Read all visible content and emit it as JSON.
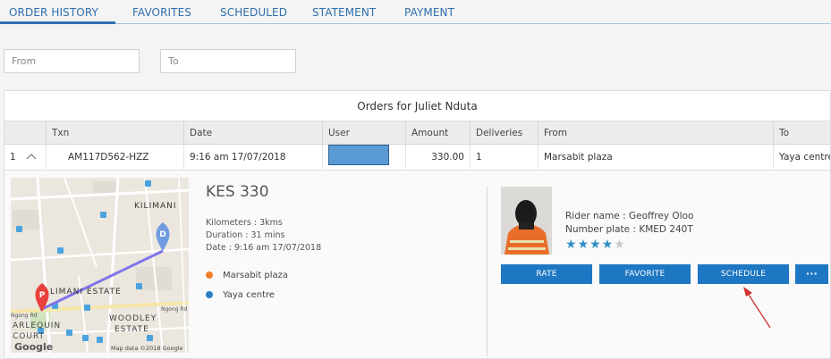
{
  "tabs": [
    {
      "label": "ORDER HISTORY",
      "active": true
    },
    {
      "label": "FAVORITES"
    },
    {
      "label": "SCHEDULED"
    },
    {
      "label": "STATEMENT"
    },
    {
      "label": "PAYMENT"
    }
  ],
  "filters": {
    "from_placeholder": "From",
    "to_placeholder": "To"
  },
  "grid": {
    "title": "Orders for Juliet Nduta",
    "columns": [
      "",
      "Txn",
      "Date",
      "User",
      "Amount",
      "Deliveries",
      "From",
      "To"
    ],
    "rows": [
      {
        "index": "1",
        "txn": "AM117D562-HZZ",
        "date": "9:16 am 17/07/2018",
        "user": "",
        "amount": "330.00",
        "deliveries": "1",
        "from": "Marsabit plaza",
        "to": "Yaya centre"
      }
    ]
  },
  "detail": {
    "price": "KES 330",
    "kilometers": "Kilometers : 3kms",
    "duration": "Duration : 31 mins",
    "date": "Date : 9:16 am 17/07/2018",
    "stops": [
      {
        "label": "Marsabit plaza",
        "color": "#f07f2a"
      },
      {
        "label": "Yaya centre",
        "color": "#2a7fc8"
      }
    ],
    "rider_name": "Rider name : Geoffrey Oloo",
    "number_plate": "Number plate : KMED 240T",
    "rating": 4,
    "rating_max": 5,
    "buttons": {
      "rate": "RATE",
      "favorite": "FAVORITE",
      "schedule": "SCHEDULE",
      "more": "···"
    },
    "accent_color": "#1e77c2"
  },
  "map": {
    "labels": {
      "kilimani": "KILIMANI",
      "kilimani_estate": "LIMANI ESTATE",
      "woodley1": "WOODLEY",
      "woodley2": "ESTATE",
      "harlequin": "ARLEQUIN",
      "court": "COURT",
      "ngong_left": "Ngong Rd",
      "ngong_right": "Ngong Rd",
      "copyright": "Map data ©2018 Google",
      "google": "Google"
    },
    "pin_start": "P",
    "pin_end": "D"
  }
}
